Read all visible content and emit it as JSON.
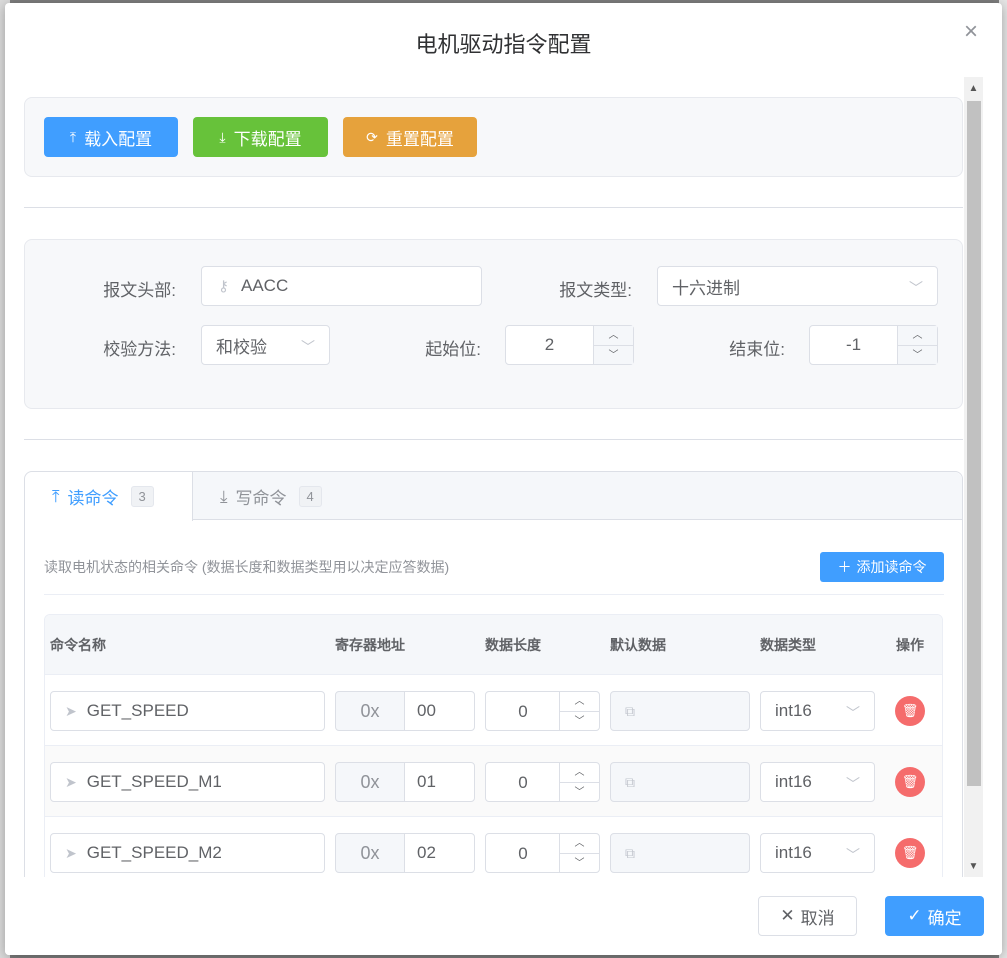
{
  "dialog": {
    "title": "电机驱动指令配置",
    "close_icon": "close-icon"
  },
  "toolbar": {
    "load_label": "载入配置",
    "download_label": "下载配置",
    "reset_label": "重置配置"
  },
  "form": {
    "header_label": "报文头部:",
    "header_value": "AACC",
    "type_label": "报文类型:",
    "type_value": "十六进制",
    "check_label": "校验方法:",
    "check_value": "和校验",
    "start_label": "起始位:",
    "start_value": "2",
    "end_label": "结束位:",
    "end_value": "-1"
  },
  "tabs": [
    {
      "label": "读命令",
      "count": "3",
      "active": true
    },
    {
      "label": "写命令",
      "count": "4",
      "active": false
    }
  ],
  "read_tab": {
    "description": "读取电机状态的相关命令 (数据长度和数据类型用以决定应答数据)",
    "add_label": "添加读命令"
  },
  "table": {
    "headers": [
      "命令名称",
      "寄存器地址",
      "数据长度",
      "默认数据",
      "数据类型",
      "操作"
    ],
    "addr_prefix": "0x",
    "rows": [
      {
        "name": "GET_SPEED",
        "addr": "00",
        "length": "0",
        "type": "int16"
      },
      {
        "name": "GET_SPEED_M1",
        "addr": "01",
        "length": "0",
        "type": "int16"
      },
      {
        "name": "GET_SPEED_M2",
        "addr": "02",
        "length": "0",
        "type": "int16"
      }
    ]
  },
  "footer": {
    "cancel_label": "取消",
    "ok_label": "确定"
  },
  "colors": {
    "primary": "#409eff",
    "success": "#67c23a",
    "warning": "#e6a23c",
    "danger": "#f56c6c"
  }
}
